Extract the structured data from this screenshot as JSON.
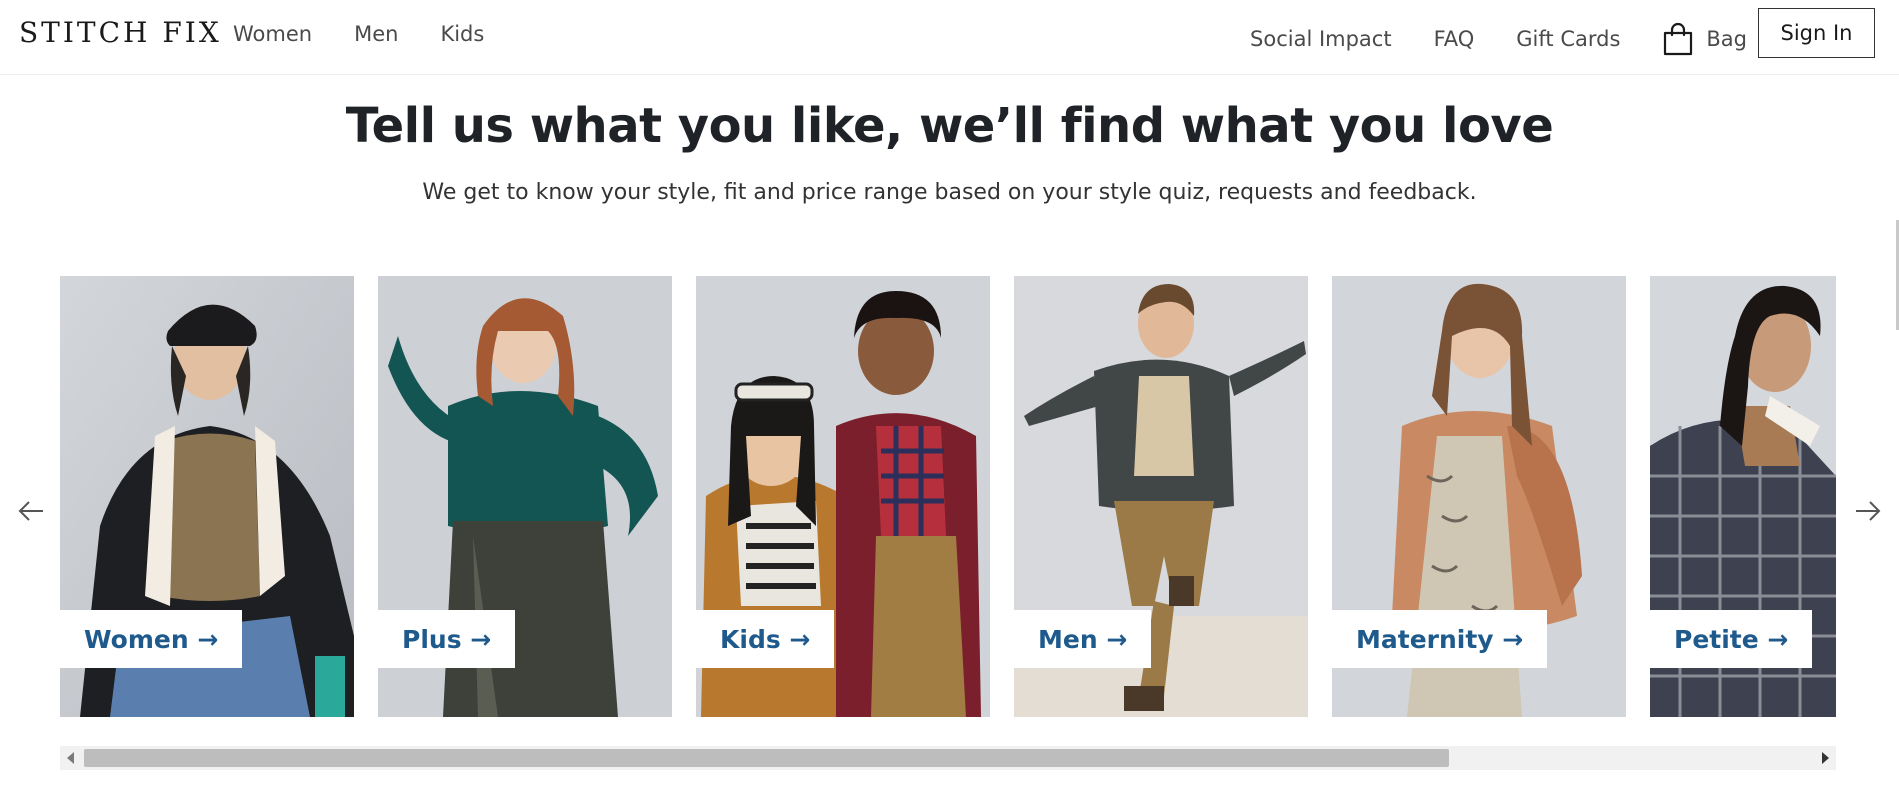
{
  "header": {
    "logo": "STITCH FIX",
    "nav_left": [
      {
        "label": "Women",
        "name": "nav-women"
      },
      {
        "label": "Men",
        "name": "nav-men"
      },
      {
        "label": "Kids",
        "name": "nav-kids"
      }
    ],
    "nav_right": [
      {
        "label": "Social Impact",
        "name": "nav-social-impact"
      },
      {
        "label": "FAQ",
        "name": "nav-faq"
      },
      {
        "label": "Gift Cards",
        "name": "nav-gift-cards"
      }
    ],
    "bag_label": "Bag",
    "bag_icon": "shopping-bag-icon",
    "signin_label": "Sign In"
  },
  "hero": {
    "headline": "Tell us what you like, we’ll find what you love",
    "subheadline": "We get to know your style, fit and price range based on your style quiz, requests and feedback."
  },
  "categories": [
    {
      "label": "Women →",
      "name": "category-women"
    },
    {
      "label": "Plus →",
      "name": "category-plus"
    },
    {
      "label": "Kids →",
      "name": "category-kids"
    },
    {
      "label": "Men →",
      "name": "category-men"
    },
    {
      "label": "Maternity →",
      "name": "category-maternity"
    },
    {
      "label": "Petite →",
      "name": "category-petite"
    }
  ],
  "carousel": {
    "prev_icon": "arrow-left-icon",
    "next_icon": "arrow-right-icon",
    "scroll_position": 0.0,
    "visible_fraction": 0.79
  },
  "colors": {
    "category_label": "#1f5a8c",
    "text": "#1f2328"
  }
}
